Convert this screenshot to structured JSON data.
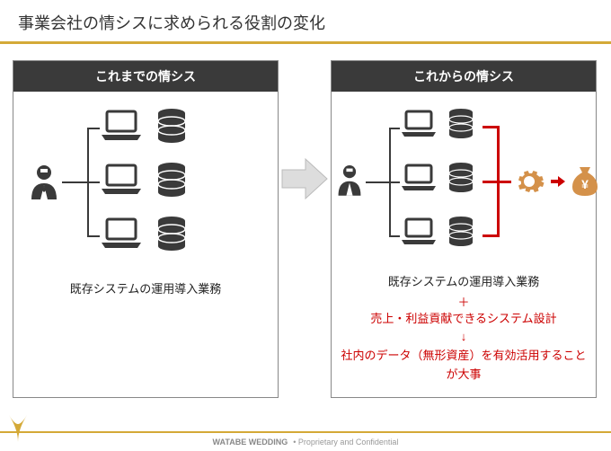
{
  "title": "事業会社の情シスに求められる役割の変化",
  "left": {
    "header": "これまでの情シス",
    "caption": "既存システムの運用導入業務"
  },
  "right": {
    "header": "これからの情シス",
    "caption": "既存システムの運用導入業務",
    "plus": "＋",
    "line1": "売上・利益貢献できるシステム設計",
    "arrow": "↓",
    "line2": "社内のデータ（無形資産）を有効活用することが大事"
  },
  "footer": {
    "brand": "WATABE WEDDING",
    "note": "•  Proprietary and Confidential"
  },
  "icons": {
    "user": "user-icon",
    "laptop": "laptop-icon",
    "db": "database-icon",
    "gear": "gear-icon",
    "moneybag": "moneybag-icon",
    "arrow": "arrow-right-icon"
  }
}
